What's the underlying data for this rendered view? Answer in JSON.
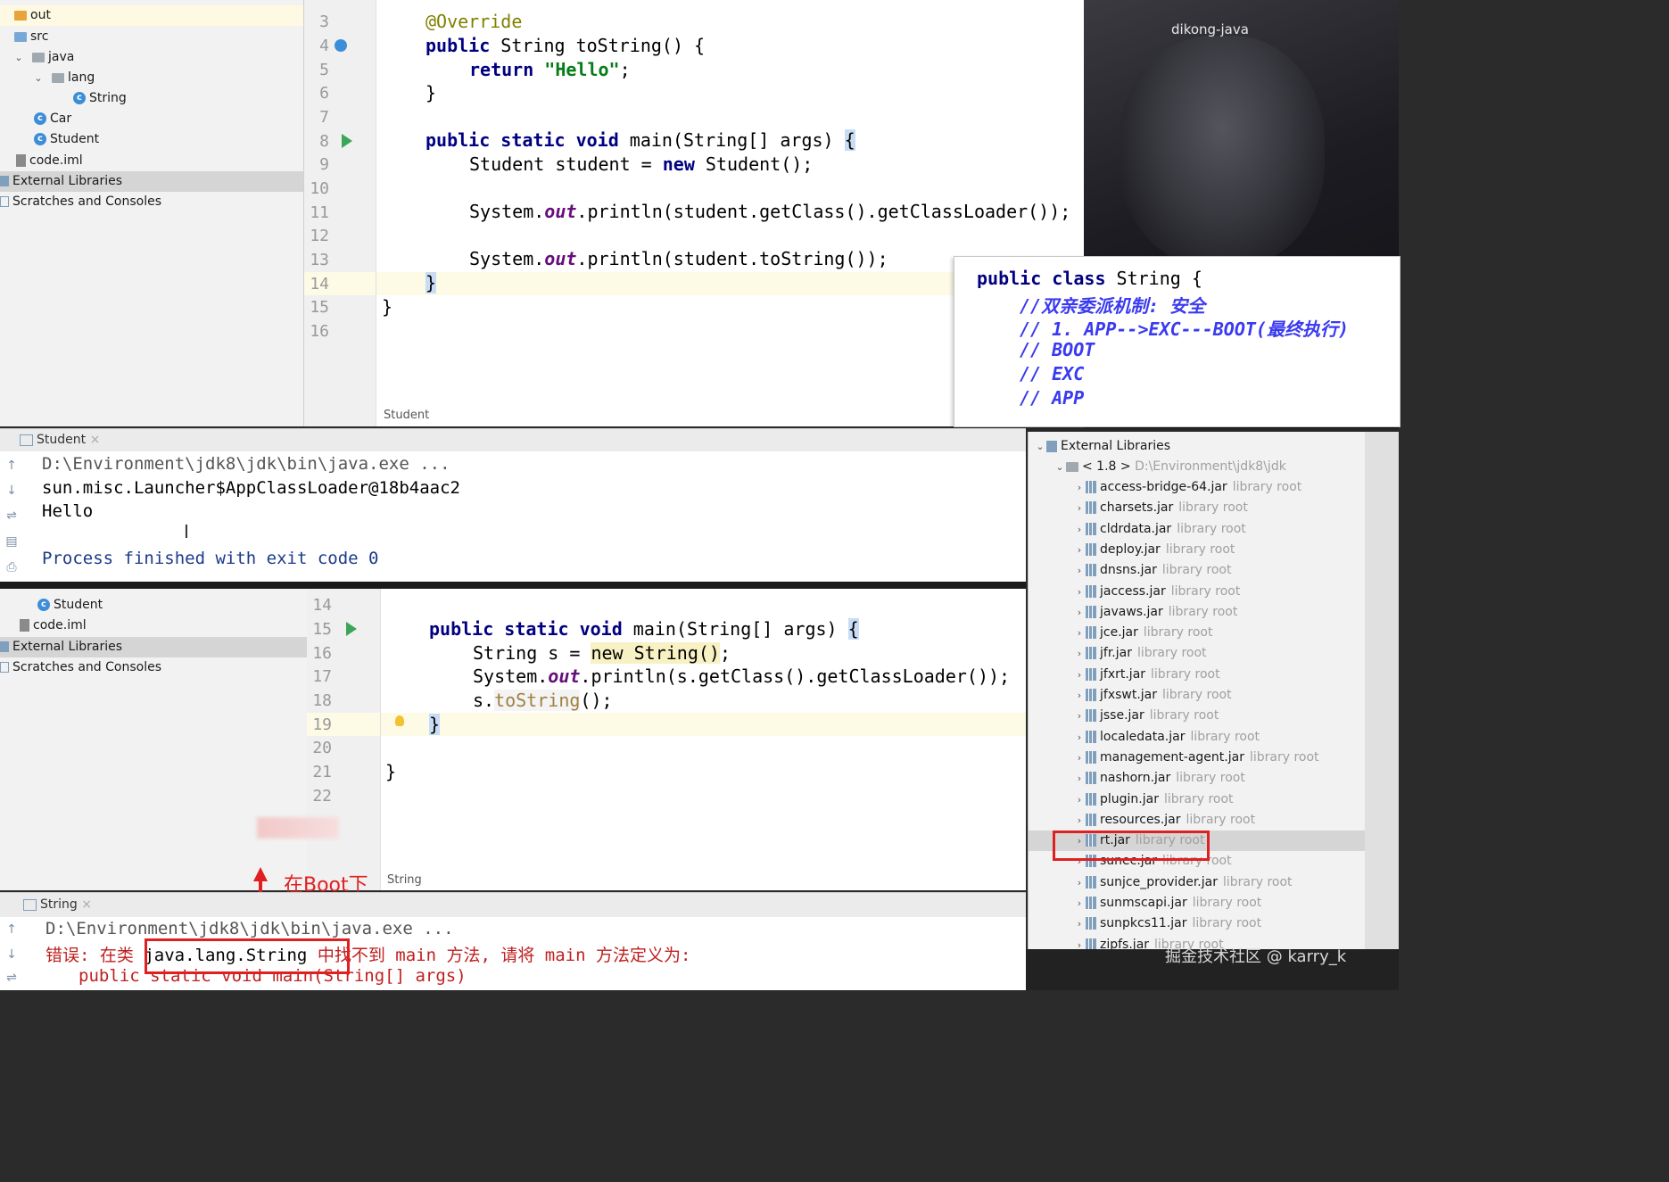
{
  "webcam": {
    "name": "dikong-java"
  },
  "project_tree_top": {
    "items": [
      {
        "label": "out",
        "icon": "folder-icon"
      },
      {
        "label": "src",
        "icon": "folder-icon"
      },
      {
        "label": "java",
        "icon": "folder-icon"
      },
      {
        "label": "lang",
        "icon": "folder-icon"
      },
      {
        "label": "String",
        "icon": "class-icon"
      },
      {
        "label": "Car",
        "icon": "class-icon"
      },
      {
        "label": "Student",
        "icon": "class-icon"
      },
      {
        "label": "code.iml",
        "icon": "file-icon"
      },
      {
        "label": "External Libraries",
        "icon": "library-icon"
      },
      {
        "label": "Scratches and Consoles",
        "icon": "scratches-icon"
      }
    ]
  },
  "editor_top": {
    "line_numbers": [
      "3",
      "4",
      "5",
      "6",
      "7",
      "8",
      "9",
      "10",
      "11",
      "12",
      "13",
      "14",
      "15",
      "16"
    ],
    "lines": [
      [
        "",
        "@Override"
      ],
      [
        "public String toString() {"
      ],
      [
        "return",
        " \"Hello\";"
      ],
      [
        "}"
      ],
      [
        ""
      ],
      [
        "public static void main(String[] args) {"
      ],
      [
        "Student student = new Student();"
      ],
      [
        ""
      ],
      [
        "System.out.println(student.getClass().getClassLoader());"
      ],
      [
        ""
      ],
      [
        "System.out.println(student.toString());"
      ],
      [
        "}"
      ],
      [
        "}"
      ],
      [
        ""
      ]
    ],
    "l3": "@Override",
    "l4a": "public",
    "l4b": " String toString() {",
    "l5a": "return",
    "l5b": "\"Hello\"",
    "l5c": ";",
    "l6": "}",
    "l8a": "public static void",
    "l8b": " main(String[] args) ",
    "l8c": "{",
    "l9a": "Student student = ",
    "l9b": "new",
    "l9c": " Student();",
    "l11a": "System.",
    "l11b": "out",
    "l11c": ".println(student.getClass().getClassLoader());",
    "l13a": "System.",
    "l13b": "out",
    "l13c": ".println(student.toString());",
    "l14": "}",
    "l15": "}",
    "breadcrumb": "Student"
  },
  "popup": {
    "l1a": "public class",
    "l1b": " String {",
    "l2": "//双亲委派机制: 安全",
    "l3": "// 1. APP-->EXC---BOOT(最终执行)",
    "l4": "// BOOT",
    "l5": "// EXC",
    "l6": "// APP"
  },
  "run_top": {
    "tab": "Student",
    "lines": {
      "cmd": "D:\\Environment\\jdk8\\jdk\\bin\\java.exe ...",
      "loader": "sun.misc.Launcher$AppClassLoader@18b4aac2",
      "hello": "Hello",
      "exit": "Process finished with exit code 0"
    }
  },
  "project_tree_bottom": {
    "items": [
      {
        "label": "Student",
        "icon": "class-icon"
      },
      {
        "label": "code.iml",
        "icon": "file-icon"
      },
      {
        "label": "External Libraries",
        "icon": "library-icon"
      },
      {
        "label": "Scratches and Consoles",
        "icon": "scratches-icon"
      }
    ]
  },
  "editor_bottom": {
    "line_numbers": [
      "14",
      "15",
      "16",
      "17",
      "18",
      "19",
      "20",
      "21",
      "22"
    ],
    "l15a": "public static void",
    "l15b": " main(String[] args) ",
    "l15c": "{",
    "l16a": "String s = ",
    "l16b": "new String()",
    "l16c": ";",
    "l17a": "System.",
    "l17b": "out",
    "l17c": ".println(s.getClass().getClassLoader());",
    "l18a": "s.",
    "l18b": "toString",
    "l18c": "();",
    "l19": "}",
    "l21": "}",
    "breadcrumb": "String",
    "annotation": "在Boot下"
  },
  "run_bottom": {
    "tab": "String",
    "cmd": "D:\\Environment\\jdk8\\jdk\\bin\\java.exe ...",
    "err_a": "错误: 在类",
    "err_b": "java.lang.String",
    "err_c": "中找不到 main 方法, 请将 main 方法定义为:",
    "err_d": "public static void main(String[] args)"
  },
  "libraries": {
    "root": "External Libraries",
    "jdk_label": "< 1.8 >",
    "jdk_path": "D:\\Environment\\jdk8\\jdk",
    "root_suffix": "library root",
    "jars": [
      "access-bridge-64.jar",
      "charsets.jar",
      "cldrdata.jar",
      "deploy.jar",
      "dnsns.jar",
      "jaccess.jar",
      "javaws.jar",
      "jce.jar",
      "jfr.jar",
      "jfxrt.jar",
      "jfxswt.jar",
      "jsse.jar",
      "localedata.jar",
      "management-agent.jar",
      "nashorn.jar",
      "plugin.jar",
      "resources.jar",
      "rt.jar",
      "sunec.jar",
      "sunjce_provider.jar",
      "sunmscapi.jar",
      "sunpkcs11.jar",
      "zipfs.jar"
    ]
  },
  "watermark": "掘金技术社区 @ karry_k",
  "colors": {
    "keyword": "#000080",
    "string": "#067d17",
    "comment": "#3a3af0",
    "annotation_red": "#e02020"
  }
}
